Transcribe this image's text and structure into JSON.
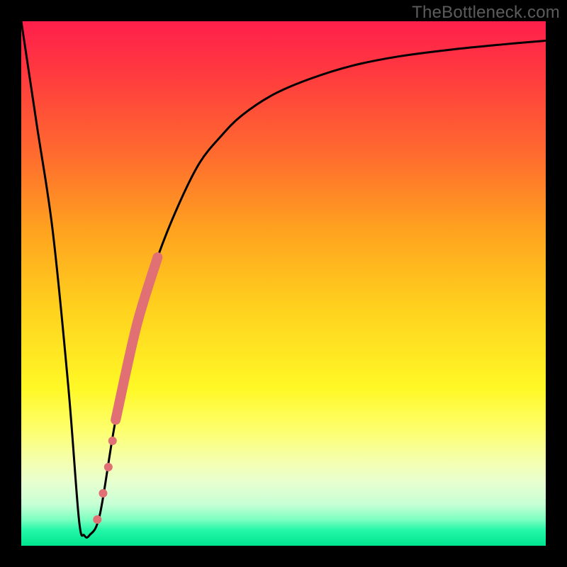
{
  "watermark": "TheBottleneck.com",
  "chart_data": {
    "type": "line",
    "title": "",
    "xlabel": "",
    "ylabel": "",
    "xlim": [
      0,
      100
    ],
    "ylim": [
      0,
      100
    ],
    "grid": false,
    "series": [
      {
        "name": "bottleneck-curve",
        "x": [
          0,
          3,
          6,
          9,
          11,
          12,
          13,
          15,
          18,
          22,
          26,
          30,
          34,
          38,
          42,
          48,
          55,
          63,
          72,
          82,
          92,
          100
        ],
        "y": [
          100,
          80,
          60,
          30,
          5,
          2,
          2,
          6,
          24,
          42,
          55,
          65,
          73,
          78,
          82,
          86,
          89,
          91.5,
          93.3,
          94.6,
          95.6,
          96.3
        ],
        "color": "#000000",
        "stroke_width": 2
      }
    ],
    "highlight_segment": {
      "name": "highlight-band",
      "color": "#e07074",
      "stroke_width": 14,
      "path_indices_from": 8,
      "path_indices_to": 10,
      "x": [
        18,
        22,
        26
      ],
      "y": [
        24,
        42,
        55
      ]
    },
    "highlight_dots": {
      "name": "highlight-dots",
      "color": "#e07074",
      "radius": 6,
      "points": [
        {
          "x": 15.6,
          "y": 10
        },
        {
          "x": 16.6,
          "y": 15
        },
        {
          "x": 17.4,
          "y": 20
        },
        {
          "x": 14.5,
          "y": 5
        }
      ]
    }
  }
}
